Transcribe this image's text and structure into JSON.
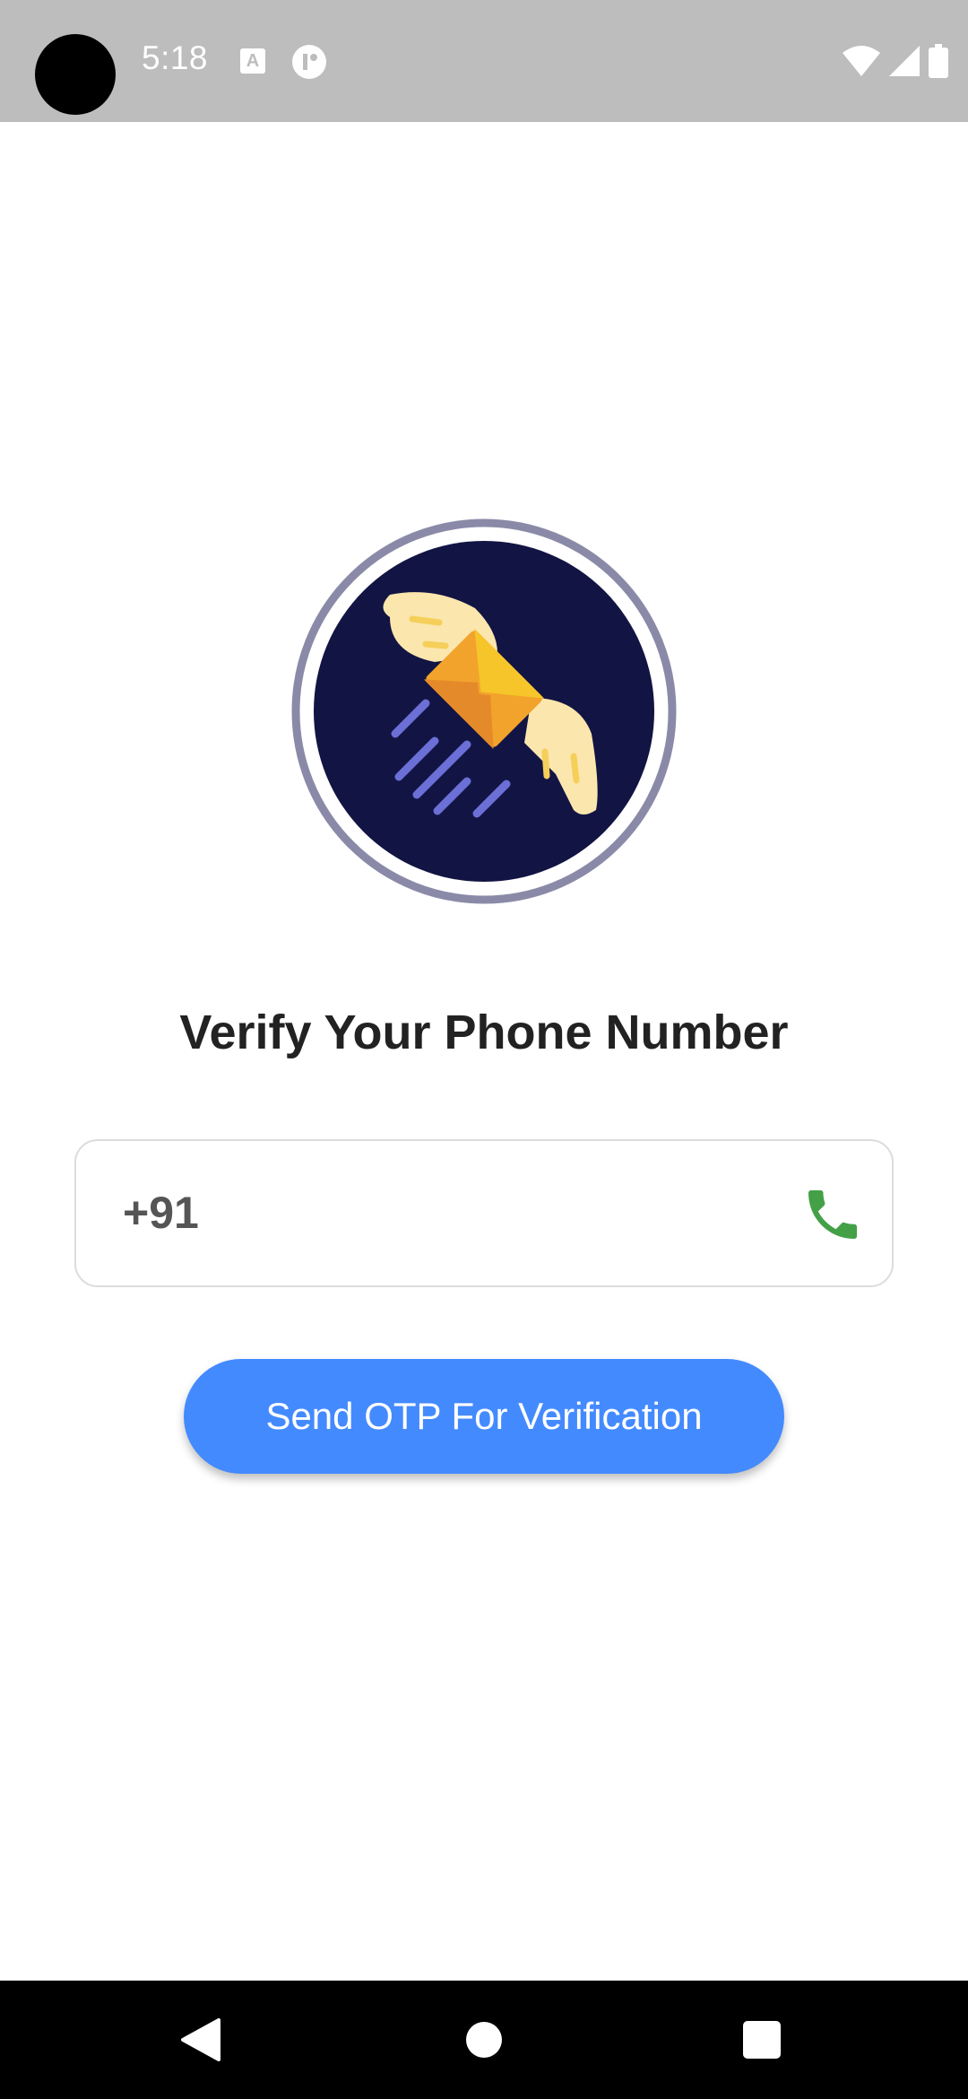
{
  "status_bar": {
    "time": "5:18",
    "notification_icons": [
      "a-icon",
      "circle-app-icon"
    ],
    "system_icons": [
      "wifi-icon",
      "signal-icon",
      "battery-icon"
    ]
  },
  "logo": {
    "icon": "winged-envelope-icon",
    "colors": {
      "ring_outer": "#8a8aa8",
      "circle_fill": "#121443",
      "envelope": "#f2a32b",
      "wings": "#fbe6ae",
      "speed_lines": "#6b6fd6"
    }
  },
  "title": "Verify Your Phone Number",
  "phone_field": {
    "value": "+91",
    "placeholder": "",
    "icon": "phone-icon",
    "icon_color": "#43a047"
  },
  "send_button": {
    "label": "Send OTP For Verification",
    "color": "#448aff"
  },
  "nav_bar": {
    "buttons": [
      "back-icon",
      "home-icon",
      "recents-icon"
    ]
  }
}
